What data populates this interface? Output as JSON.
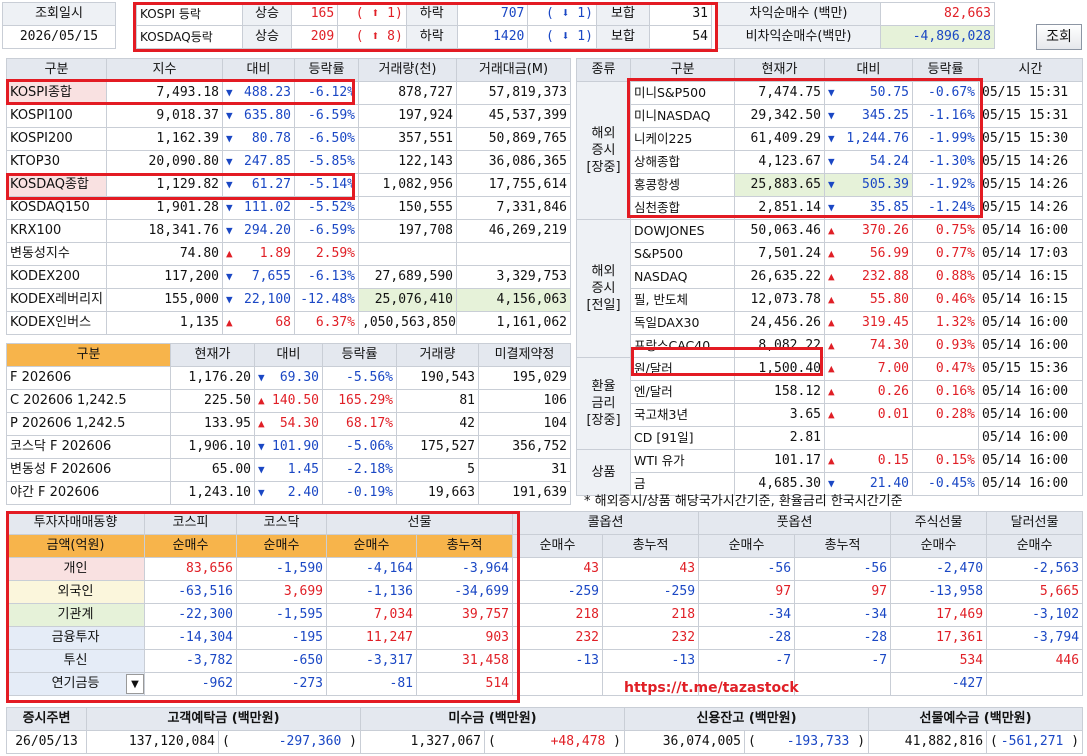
{
  "top": {
    "query_label": "조회일시",
    "query_date": "2026/05/15",
    "rows": [
      {
        "name": "KOSPI 등락",
        "up_label": "상승",
        "up_count": "165",
        "up_limit": "1",
        "down_label": "하락",
        "down_count": "707",
        "down_limit": "1",
        "flat_label": "보합",
        "flat_count": "31"
      },
      {
        "name": "KOSDAQ등락",
        "up_label": "상승",
        "up_count": "209",
        "up_limit": "8",
        "down_label": "하락",
        "down_count": "1420",
        "down_limit": "1",
        "flat_label": "보합",
        "flat_count": "54"
      }
    ],
    "arb": [
      {
        "label": "차익순매수 (백만)",
        "value": "82,663"
      },
      {
        "label": "비차익순매수(백만)",
        "value": "-4,896,028"
      }
    ],
    "refresh_label": "조회"
  },
  "index_table": {
    "headers": [
      "구분",
      "지수",
      "대비",
      "등락률",
      "거래량(천)",
      "거래대금(M)"
    ],
    "rows": [
      {
        "name": "KOSPI종합",
        "value": "7,493.18",
        "dir": "down",
        "change": "488.23",
        "rate": "-6.12%",
        "volume": "878,727",
        "amount": "57,819,373"
      },
      {
        "name": "KOSPI100",
        "value": "9,018.37",
        "dir": "down",
        "change": "635.80",
        "rate": "-6.59%",
        "volume": "197,924",
        "amount": "45,537,399"
      },
      {
        "name": "KOSPI200",
        "value": "1,162.39",
        "dir": "down",
        "change": "80.78",
        "rate": "-6.50%",
        "volume": "357,551",
        "amount": "50,869,765"
      },
      {
        "name": "KTOP30",
        "value": "20,090.80",
        "dir": "down",
        "change": "247.85",
        "rate": "-5.85%",
        "volume": "122,143",
        "amount": "36,086,365"
      },
      {
        "name": "KOSDAQ종합",
        "value": "1,129.82",
        "dir": "down",
        "change": "61.27",
        "rate": "-5.14%",
        "volume": "1,082,956",
        "amount": "17,755,614"
      },
      {
        "name": "KOSDAQ150",
        "value": "1,901.28",
        "dir": "down",
        "change": "111.02",
        "rate": "-5.52%",
        "volume": "150,555",
        "amount": "7,331,846"
      },
      {
        "name": "KRX100",
        "value": "18,341.76",
        "dir": "down",
        "change": "294.20",
        "rate": "-6.59%",
        "volume": "197,708",
        "amount": "46,269,219"
      },
      {
        "name": "변동성지수",
        "value": "74.80",
        "dir": "up",
        "change": "1.89",
        "rate": "2.59%",
        "volume": "",
        "amount": ""
      },
      {
        "name": "KODEX200",
        "value": "117,200",
        "dir": "down",
        "change": "7,655",
        "rate": "-6.13%",
        "volume": "27,689,590",
        "amount": "3,329,753"
      },
      {
        "name": "KODEX레버리지",
        "value": "155,000",
        "dir": "down",
        "change": "22,100",
        "rate": "-12.48%",
        "volume": "25,076,410",
        "amount": "4,156,063"
      },
      {
        "name": "KODEX인버스",
        "value": "1,135",
        "dir": "up",
        "change": "68",
        "rate": "6.37%",
        "volume": ",050,563,850",
        "amount": "1,161,062"
      }
    ]
  },
  "deriv_table": {
    "headers": [
      "구분",
      "현재가",
      "대비",
      "등락률",
      "거래량",
      "미결제약정"
    ],
    "rows": [
      {
        "name": "F 202606",
        "value": "1,176.20",
        "dir": "down",
        "change": "69.30",
        "rate": "-5.56%",
        "volume": "190,543",
        "oi": "195,029"
      },
      {
        "name": "C 202606 1,242.5",
        "value": "225.50",
        "dir": "up",
        "change": "140.50",
        "rate": "165.29%",
        "volume": "81",
        "oi": "106"
      },
      {
        "name": "P 202606 1,242.5",
        "value": "133.95",
        "dir": "up",
        "change": "54.30",
        "rate": "68.17%",
        "volume": "42",
        "oi": "104"
      },
      {
        "name": "코스닥 F 202606",
        "value": "1,906.10",
        "dir": "down",
        "change": "101.90",
        "rate": "-5.06%",
        "volume": "175,527",
        "oi": "356,752"
      },
      {
        "name": "변동성 F 202606",
        "value": "65.00",
        "dir": "down",
        "change": "1.45",
        "rate": "-2.18%",
        "volume": "5",
        "oi": "31"
      },
      {
        "name": "야간 F 202606",
        "value": "1,243.10",
        "dir": "down",
        "change": "2.40",
        "rate": "-0.19%",
        "volume": "19,663",
        "oi": "191,639"
      }
    ]
  },
  "global_table": {
    "headers": [
      "종류",
      "구분",
      "현재가",
      "대비",
      "등락률",
      "시간"
    ],
    "groups": [
      {
        "label": "해외\n증시\n[장중]",
        "rows": [
          {
            "name": "미니S&P500",
            "value": "7,474.75",
            "dir": "down",
            "change": "50.75",
            "rate": "-0.67%",
            "time": "05/15 15:31"
          },
          {
            "name": "미니NASDAQ",
            "value": "29,342.50",
            "dir": "down",
            "change": "345.25",
            "rate": "-1.16%",
            "time": "05/15 15:31"
          },
          {
            "name": "니케이225",
            "value": "61,409.29",
            "dir": "down",
            "change": "1,244.76",
            "rate": "-1.99%",
            "time": "05/15 15:30"
          },
          {
            "name": "상해종합",
            "value": "4,123.67",
            "dir": "down",
            "change": "54.24",
            "rate": "-1.30%",
            "time": "05/15 14:26"
          },
          {
            "name": "홍콩항셍",
            "value": "25,883.65",
            "dir": "down",
            "change": "505.39",
            "rate": "-1.92%",
            "time": "05/15 14:26"
          },
          {
            "name": "심천종합",
            "value": "2,851.14",
            "dir": "down",
            "change": "35.85",
            "rate": "-1.24%",
            "time": "05/15 14:26"
          }
        ]
      },
      {
        "label": "해외\n증시\n[전일]",
        "rows": [
          {
            "name": "DOWJONES",
            "value": "50,063.46",
            "dir": "up",
            "change": "370.26",
            "rate": "0.75%",
            "time": "05/14 16:00"
          },
          {
            "name": "S&P500",
            "value": "7,501.24",
            "dir": "up",
            "change": "56.99",
            "rate": "0.77%",
            "time": "05/14 17:03"
          },
          {
            "name": "NASDAQ",
            "value": "26,635.22",
            "dir": "up",
            "change": "232.88",
            "rate": "0.88%",
            "time": "05/14 16:15"
          },
          {
            "name": "필, 반도체",
            "value": "12,073.78",
            "dir": "up",
            "change": "55.80",
            "rate": "0.46%",
            "time": "05/14 16:15"
          },
          {
            "name": "독일DAX30",
            "value": "24,456.26",
            "dir": "up",
            "change": "319.45",
            "rate": "1.32%",
            "time": "05/14 16:00"
          },
          {
            "name": "프랑스CAC40",
            "value": "8,082.22",
            "dir": "up",
            "change": "74.30",
            "rate": "0.93%",
            "time": "05/14 16:00"
          }
        ]
      },
      {
        "label": "환율\n금리\n[장중]",
        "rows": [
          {
            "name": "원/달러",
            "value": "1,500.40",
            "dir": "up",
            "change": "7.00",
            "rate": "0.47%",
            "time": "05/15 15:36"
          },
          {
            "name": "엔/달러",
            "value": "158.12",
            "dir": "up",
            "change": "0.26",
            "rate": "0.16%",
            "time": "05/14 16:00"
          },
          {
            "name": "국고채3년",
            "value": "3.65",
            "dir": "up",
            "change": "0.01",
            "rate": "0.28%",
            "time": "05/14 16:00"
          },
          {
            "name": "CD [91일]",
            "value": "2.81",
            "dir": "",
            "change": "",
            "rate": "",
            "time": "05/14 16:00"
          }
        ]
      },
      {
        "label": "상품",
        "rows": [
          {
            "name": "WTI 유가",
            "value": "101.17",
            "dir": "up",
            "change": "0.15",
            "rate": "0.15%",
            "time": "05/14 16:00"
          },
          {
            "name": "금",
            "value": "4,685.30",
            "dir": "down",
            "change": "21.40",
            "rate": "-0.45%",
            "time": "05/14 16:00"
          }
        ]
      }
    ],
    "note": "* 해외증시/상품 해당국가시간기준, 환율금리 한국시간기준"
  },
  "investor_table": {
    "title": "투자자매매동향",
    "unit_label": "금액(억원)",
    "groups": [
      "코스피",
      "코스닥",
      "선물",
      "콜옵션",
      "풋옵션",
      "주식선물",
      "달러선물"
    ],
    "subheaders": [
      "순매수",
      "순매수",
      "순매수",
      "총누적",
      "순매수",
      "총누적",
      "순매수",
      "총누적",
      "순매수",
      "순매수"
    ],
    "rows": [
      {
        "name": "개인",
        "values": [
          "83,656",
          "-1,590",
          "-4,164",
          "-3,964",
          "43",
          "43",
          "-56",
          "-56",
          "-2,470",
          "-2,563"
        ]
      },
      {
        "name": "외국인",
        "values": [
          "-63,516",
          "3,699",
          "-1,136",
          "-34,699",
          "-259",
          "-259",
          "97",
          "97",
          "-13,958",
          "5,665"
        ]
      },
      {
        "name": "기관계",
        "values": [
          "-22,300",
          "-1,595",
          "7,034",
          "39,757",
          "218",
          "218",
          "-34",
          "-34",
          "17,469",
          "-3,102"
        ]
      },
      {
        "name": "금융투자",
        "values": [
          "-14,304",
          "-195",
          "11,247",
          "903",
          "232",
          "232",
          "-28",
          "-28",
          "17,361",
          "-3,794"
        ]
      },
      {
        "name": "투신",
        "values": [
          "-3,782",
          "-650",
          "-3,317",
          "31,458",
          "-13",
          "-13",
          "-7",
          "-7",
          "534",
          "446"
        ]
      },
      {
        "name": "연기금등",
        "values": [
          "-962",
          "-273",
          "-81",
          "514",
          "",
          "",
          "",
          "",
          "-427",
          ""
        ]
      }
    ],
    "link_text": "https://t.me/tazastock"
  },
  "bottom": {
    "headers": [
      "증시주변",
      "고객예탁금 (백만원)",
      "미수금 (백만원)",
      "신용잔고 (백만원)",
      "선물예수금 (백만원)"
    ],
    "date": "26/05/13",
    "items": [
      {
        "value": "137,120,084",
        "change": "-297,360"
      },
      {
        "value": "1,327,067",
        "change": "+48,478"
      },
      {
        "value": "36,074,005",
        "change": "-193,733"
      },
      {
        "value": "41,882,816",
        "change": "-561,271"
      }
    ]
  },
  "colors": {
    "up": "#e01f26",
    "down": "#1a47c4",
    "accent": "#f7b44b",
    "highlight": "#e31b23"
  }
}
